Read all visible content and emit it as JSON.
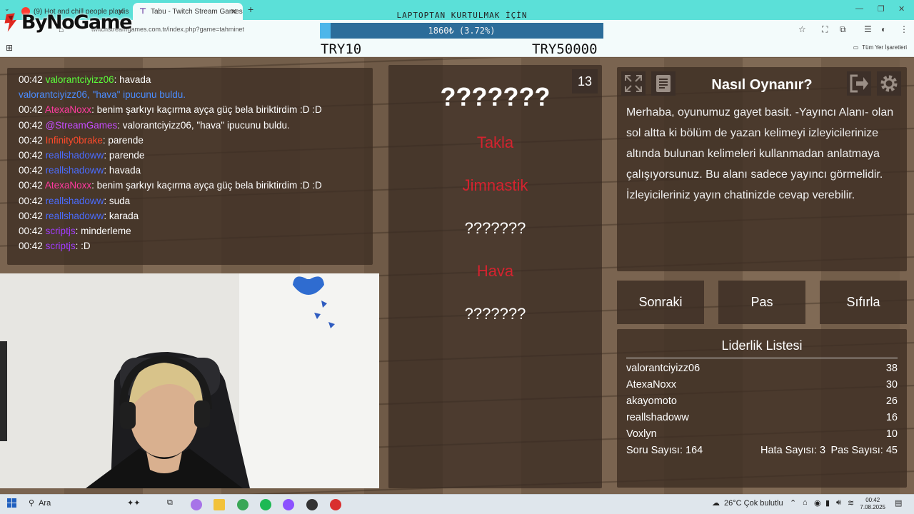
{
  "browser": {
    "tabs": [
      {
        "label": "(9) Hot and chill people playlis",
        "active": false
      },
      {
        "label": "Tabu - Twitch Stream Games",
        "active": true
      }
    ],
    "new_tab_icon": "plus-icon",
    "url": "twitchstreamgames.com.tr/index.php?game=tahminet",
    "bookmarks_all": "Tüm Yer İşaretleri"
  },
  "logo": {
    "text": "ByNoGame"
  },
  "donation": {
    "title": "LAPTOPTAN KURTULMAK İÇİN",
    "progress_text": "1860₺ (3.72%)",
    "progress": 0.0372,
    "min_label": "TRY10",
    "max_label": "TRY50000"
  },
  "chat": {
    "messages": [
      {
        "time": "00:42",
        "user": "valorantciyizz06",
        "color": "#5bff3a",
        "text": ": havada"
      },
      {
        "time": "",
        "user": "valorantciyizz06,",
        "color": "#4a8cff",
        "text": " \"hava\" ipucunu buldu.",
        "highlight": "\"hava\"",
        "system": true
      },
      {
        "time": "00:42",
        "user": "AtexaNoxx",
        "color": "#ff3aa0",
        "text": ": benim şarkıyı kaçırma ayça güç bela biriktirdim :D :D"
      },
      {
        "time": "00:42",
        "user": "@StreamGames",
        "color": "#c64cff",
        "text": ": valorantciyizz06, \"hava\" ipucunu buldu."
      },
      {
        "time": "00:42",
        "user": "Infinity0brake",
        "color": "#ff4a2a",
        "text": ": parende"
      },
      {
        "time": "00:42",
        "user": "reallshadoww",
        "color": "#4a6cff",
        "text": ": parende"
      },
      {
        "time": "00:42",
        "user": "reallshadoww",
        "color": "#4a6cff",
        "text": ": havada"
      },
      {
        "time": "00:42",
        "user": "AtexaNoxx",
        "color": "#ff3aa0",
        "text": ": benim şarkıyı kaçırma ayça güç bela biriktirdim :D :D"
      },
      {
        "time": "00:42",
        "user": "reallshadoww",
        "color": "#4a6cff",
        "text": ": suda"
      },
      {
        "time": "00:42",
        "user": "reallshadoww",
        "color": "#4a6cff",
        "text": ": karada"
      },
      {
        "time": "00:42",
        "user": "scriptjs",
        "color": "#a23cff",
        "text": ": minderleme"
      },
      {
        "time": "00:42",
        "user": "scriptjs",
        "color": "#a23cff",
        "text": ": :D"
      }
    ]
  },
  "cards": {
    "counter": "13",
    "main_word": "???????",
    "words": [
      {
        "text": "Takla",
        "color": "#d4232f"
      },
      {
        "text": "Jimnastik",
        "color": "#d4232f"
      },
      {
        "text": "???????",
        "color": "#ffffff"
      },
      {
        "text": "Hava",
        "color": "#d4232f"
      },
      {
        "text": "???????",
        "color": "#ffffff"
      }
    ]
  },
  "howto": {
    "title": "Nasıl Oynanır?",
    "body": "Merhaba, oyunumuz gayet basit. -Yayıncı Alanı- olan sol altta ki bölüm de yazan kelimeyi izleyicilerinize altında bulunan kelimeleri kullanmadan anlatmaya çalışıyorsunuz. Bu alanı sadece yayıncı görmelidir. İzleyicileriniz yayın chatinizde cevap verebilir.",
    "icons": [
      "fullscreen-icon",
      "document-icon",
      "exit-icon",
      "gear-icon"
    ]
  },
  "actions": {
    "next": "Sonraki",
    "pass": "Pas",
    "reset": "Sıfırla"
  },
  "leaderboard": {
    "title": "Liderlik Listesi",
    "rows": [
      {
        "name": "valorantciyizz06",
        "score": "38"
      },
      {
        "name": "AtexaNoxx",
        "score": "30"
      },
      {
        "name": "akayomoto",
        "score": "26"
      },
      {
        "name": "reallshadoww",
        "score": "16"
      },
      {
        "name": "Voxlyn",
        "score": "10"
      }
    ],
    "stats": {
      "questions": "Soru Sayısı: 164",
      "errors": "Hata Sayısı: 3",
      "passes": "Pas Sayısı: 45"
    }
  },
  "taskbar": {
    "search_label": "Ara",
    "weather": "26°C  Çok bulutlu",
    "time": "00:42",
    "date": "7.08.2025"
  }
}
